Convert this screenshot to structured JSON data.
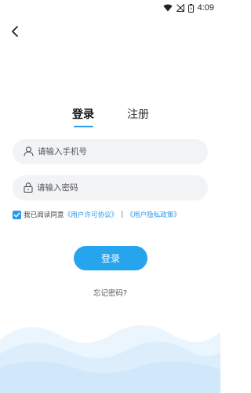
{
  "status_bar": {
    "time": "4:09",
    "icons": [
      "wifi-icon",
      "signal-icon",
      "battery-icon"
    ]
  },
  "nav": {
    "back_icon": "back-arrow-icon"
  },
  "tabs": [
    {
      "label": "登录",
      "active": true
    },
    {
      "label": "注册",
      "active": false
    }
  ],
  "form": {
    "phone": {
      "placeholder": "请输入手机号",
      "value": "",
      "icon": "user-icon"
    },
    "password": {
      "placeholder": "请输入密码",
      "value": "",
      "icon": "lock-icon"
    }
  },
  "agreement": {
    "checked": true,
    "prefix": "我已阅读同意",
    "user_agreement": "《用户许可协议》",
    "separator": "|",
    "privacy_policy": "《用户隐私政策》"
  },
  "login_button": "登录",
  "forgot_password": "忘记密码?",
  "colors": {
    "accent": "#2a9be8",
    "button": "#27a4ee",
    "field_bg": "#f2f3f5",
    "wave": "#dceefb"
  }
}
